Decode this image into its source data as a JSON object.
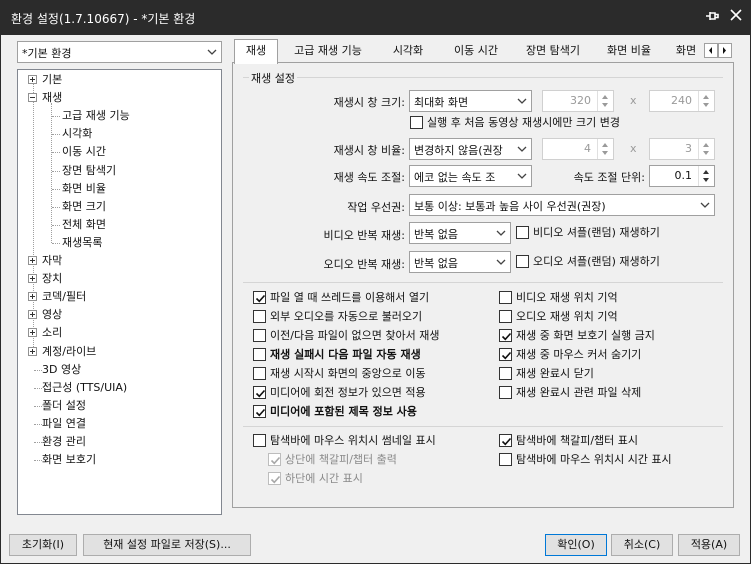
{
  "window": {
    "title": "환경 설정(1.7.10667) - *기본 환경",
    "pin_icon": "pin-icon",
    "close_icon": "close-icon"
  },
  "preset": {
    "value": "*기본 환경"
  },
  "tree": [
    {
      "label": "기본",
      "expander": "plus"
    },
    {
      "label": "재생",
      "expander": "minus"
    },
    {
      "label": "고급 재생 기능",
      "child": true
    },
    {
      "label": "시각화",
      "child": true
    },
    {
      "label": "이동 시간",
      "child": true
    },
    {
      "label": "장면 탐색기",
      "child": true
    },
    {
      "label": "화면 비율",
      "child": true
    },
    {
      "label": "화면 크기",
      "child": true
    },
    {
      "label": "전체 화면",
      "child": true
    },
    {
      "label": "재생목록",
      "child": true
    },
    {
      "label": "자막",
      "expander": "plus"
    },
    {
      "label": "장치",
      "expander": "plus"
    },
    {
      "label": "코덱/필터",
      "expander": "plus"
    },
    {
      "label": "영상",
      "expander": "plus"
    },
    {
      "label": "소리",
      "expander": "plus"
    },
    {
      "label": "계정/라이브",
      "expander": "plus"
    },
    {
      "label": "3D 영상"
    },
    {
      "label": "접근성 (TTS/UIA)"
    },
    {
      "label": "폴더 설정"
    },
    {
      "label": "파일 연결"
    },
    {
      "label": "환경 관리"
    },
    {
      "label": "화면 보호기"
    }
  ],
  "tabs": [
    "재생",
    "고급 재생 기능",
    "시각화",
    "이동 시간",
    "장면 탐색기",
    "화면 비율",
    "화면"
  ],
  "group_title": "재생 설정",
  "form": {
    "window_size_label": "재생시 창 크기:",
    "window_size_value": "최대화 화면",
    "width": "320",
    "height": "240",
    "times": "x",
    "first_only": "실행 후 처음 동영상 재생시에만 크기 변경",
    "window_ratio_label": "재생시 창 비율:",
    "window_ratio_value": "변경하지 않음(권장",
    "ratio_w": "4",
    "ratio_h": "3",
    "speed_label": "재생 속도 조절:",
    "speed_value": "에코 없는 속도 조",
    "speed_unit_label": "속도 조절 단위:",
    "speed_unit_value": "0.1",
    "priority_label": "작업 우선권:",
    "priority_value": "보통 이상: 보통과 높음 사이 우선권(권장)",
    "video_repeat_label": "비디오 반복 재생:",
    "video_repeat_value": "반복 없음",
    "video_shuffle": "비디오 셔플(랜덤) 재생하기",
    "audio_repeat_label": "오디오 반복 재생:",
    "audio_repeat_value": "반복 없음",
    "audio_shuffle": "오디오 셔플(랜덤) 재생하기"
  },
  "options_left": [
    {
      "label": "파일 열 때 쓰레드를 이용해서 열기",
      "checked": true
    },
    {
      "label": "외부 오디오를 자동으로 불러오기",
      "checked": false
    },
    {
      "label": "이전/다음 파일이 없으면 찾아서 재생",
      "checked": false
    },
    {
      "label": "재생 실패시 다음 파일 자동 재생",
      "checked": false,
      "bold": true
    },
    {
      "label": "재생 시작시 화면의 중앙으로 이동",
      "checked": false
    },
    {
      "label": "미디어에 회전 정보가 있으면 적용",
      "checked": true
    },
    {
      "label": "미디어에 포함된 제목 정보 사용",
      "checked": true,
      "bold": true
    }
  ],
  "options_right": [
    {
      "label": "비디오 재생 위치 기억",
      "checked": false
    },
    {
      "label": "오디오 재생 위치 기억",
      "checked": false
    },
    {
      "label": "재생 중 화면 보호기 실행 금지",
      "checked": true
    },
    {
      "label": "재생 중 마우스 커서 숨기기",
      "checked": true
    },
    {
      "label": "재생 완료시 닫기",
      "checked": false
    },
    {
      "label": "재생 완료시 관련 파일 삭제",
      "checked": false
    }
  ],
  "seekbar": {
    "thumbnail": "탐색바에 마우스 위치시 썸네일 표시",
    "bookmark": "탐색바에 책갈피/챕터 표시",
    "top_bookmark": "상단에 책갈피/챕터 출력",
    "bottom_time": "하단에 시간 표시",
    "mouse_time": "탐색바에 마우스 위치시 시간 표시"
  },
  "buttons": {
    "reset": "초기화(I)",
    "save_as": "현재 설정 파일로 저장(S)...",
    "ok": "확인(O)",
    "cancel": "취소(C)",
    "apply": "적용(A)"
  }
}
